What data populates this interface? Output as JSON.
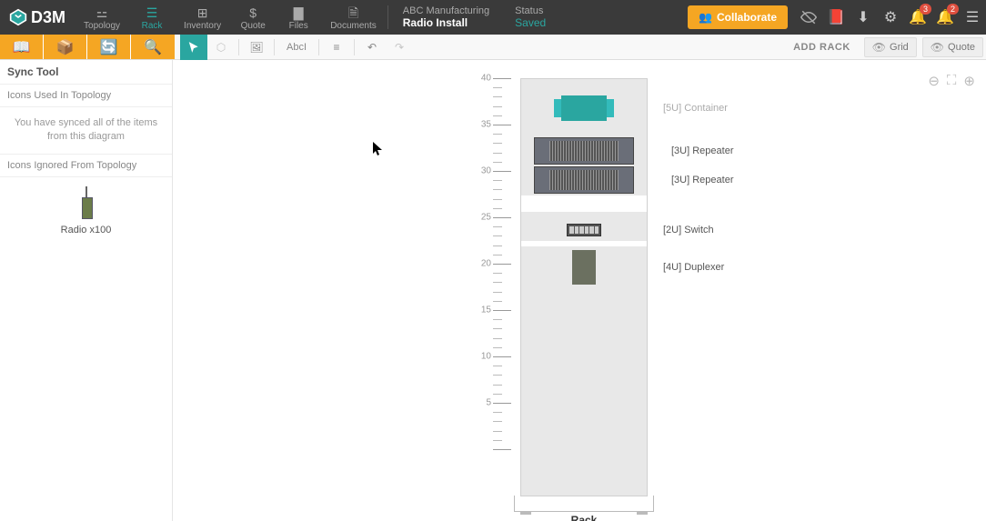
{
  "app": {
    "logo": "D3M"
  },
  "nav": {
    "topology": "Topology",
    "rack": "Rack",
    "inventory": "Inventory",
    "quote": "Quote",
    "files": "Files",
    "documents": "Documents"
  },
  "project": {
    "company": "ABC Manufacturing",
    "name": "Radio Install",
    "status_label": "Status",
    "status_value": "Saved"
  },
  "topright": {
    "collaborate": "Collaborate",
    "notif1": "3",
    "notif2": "2"
  },
  "secondbar": {
    "add_rack": "ADD RACK",
    "grid": "Grid",
    "quote": "Quote",
    "text_tool": "AbcI"
  },
  "sidebar": {
    "title": "Sync Tool",
    "icons_used_head": "Icons Used In Topology",
    "sync_note": "You have synced all of the items from this diagram",
    "icons_ignored_head": "Icons Ignored From Topology",
    "ignored_item": "Radio x100"
  },
  "rack": {
    "label": "Rack",
    "ruler": [
      "40",
      "35",
      "30",
      "25",
      "20",
      "15",
      "10",
      "5"
    ],
    "devices": {
      "container": "[5U] Container",
      "rep1": "[3U] Repeater",
      "rep2": "[3U] Repeater",
      "switch": "[2U] Switch",
      "duplexer": "[4U] Duplexer"
    }
  }
}
